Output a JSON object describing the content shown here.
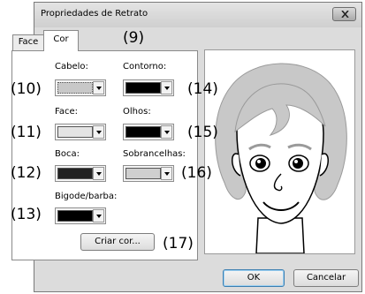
{
  "window": {
    "title": "Propriedades de Retrato"
  },
  "tabs": [
    {
      "label": "Face",
      "selected": false
    },
    {
      "label": "Cor",
      "selected": true
    }
  ],
  "colors": {
    "cabelo": {
      "label": "Cabelo:",
      "swatch": "#c8c8c8"
    },
    "contorno": {
      "label": "Contorno:",
      "swatch": "#000000"
    },
    "face": {
      "label": "Face:",
      "swatch": "#e4e4e4"
    },
    "olhos": {
      "label": "Olhos:",
      "swatch": "#000000"
    },
    "boca": {
      "label": "Boca:",
      "swatch": "#222222"
    },
    "sobrancelhas": {
      "label": "Sobrancelhas:",
      "swatch": "#cfcfcf"
    },
    "bigode": {
      "label": "Bigode/barba:",
      "swatch": "#000000"
    }
  },
  "buttons": {
    "criar_cor": "Criar cor...",
    "ok": "OK",
    "cancel": "Cancelar"
  },
  "callouts": {
    "c9": "(9)",
    "c10": "(10)",
    "c11": "(11)",
    "c12": "(12)",
    "c13": "(13)",
    "c14": "(14)",
    "c15": "(15)",
    "c16": "(16)",
    "c17": "(17)"
  },
  "icons": {
    "close": "close-icon",
    "dropdown": "chevron-down-icon",
    "portrait": "portrait-preview"
  }
}
